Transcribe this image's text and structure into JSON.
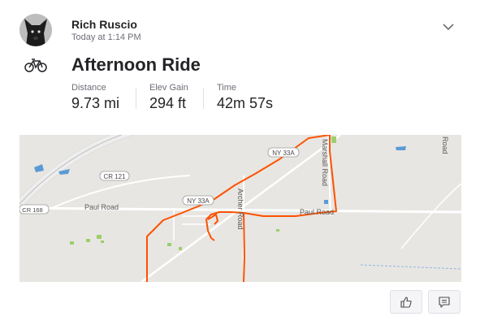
{
  "athlete": {
    "name": "Rich Ruscio",
    "timestamp": "Today at 1:14 PM"
  },
  "activity": {
    "type_icon": "bike-icon",
    "title": "Afternoon Ride",
    "stats": [
      {
        "label": "Distance",
        "value": "9.73 mi"
      },
      {
        "label": "Elev Gain",
        "value": "294 ft"
      },
      {
        "label": "Time",
        "value": "42m 57s"
      }
    ]
  },
  "map": {
    "labels": {
      "cr121": "CR 121",
      "cr168": "CR 168",
      "paul_road_left": "Paul Road",
      "paul_road_right": "Paul Road",
      "ny33a_center": "NY 33A",
      "ny33a_top": "NY 33A",
      "archer_road": "Archer Road",
      "marshall_road": "Marshall Road",
      "road_right_edge": "Road"
    },
    "colors": {
      "route": "#fc5200",
      "water": "#5b9bd5",
      "park": "#9ccf6b",
      "road": "#ffffff",
      "land": "#e8e6e2"
    }
  },
  "actions": {
    "like_icon": "thumbs-up-icon",
    "comment_icon": "comment-icon"
  }
}
